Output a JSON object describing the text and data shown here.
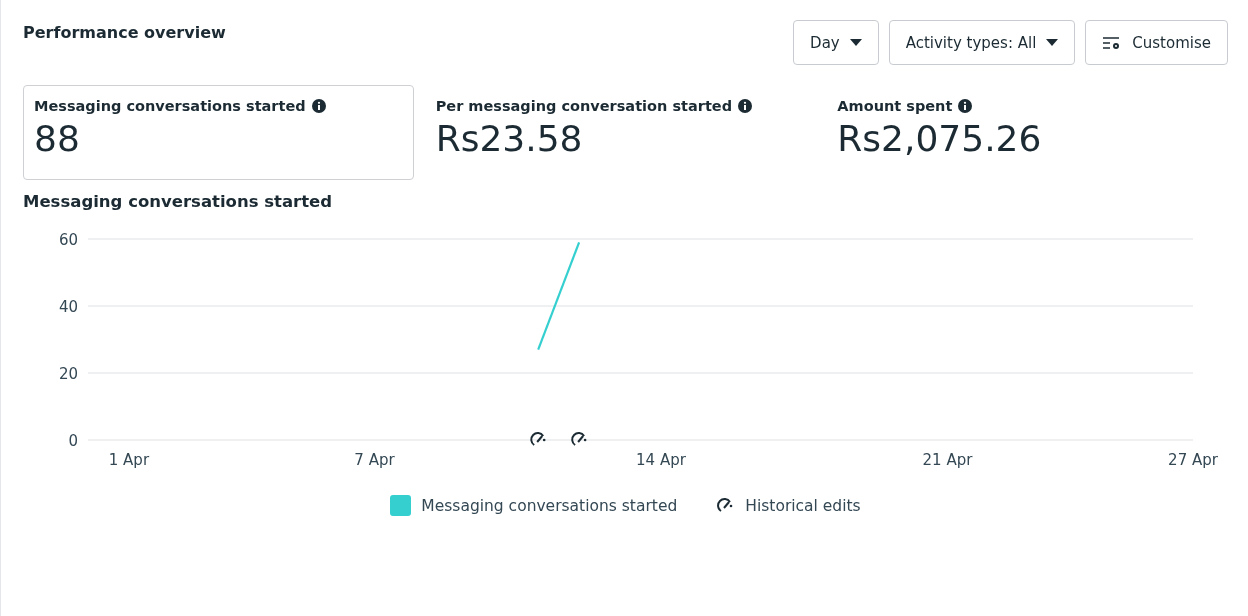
{
  "title": "Performance overview",
  "controls": [
    {
      "kind": "dropdown",
      "label": "Day"
    },
    {
      "kind": "dropdown",
      "label": "Activity types: All"
    },
    {
      "kind": "customise",
      "label": "Customise"
    }
  ],
  "metrics": [
    {
      "label": "Messaging conversations started",
      "value": "88",
      "selected": true
    },
    {
      "label": "Per messaging conversation started",
      "value": "Rs23.58",
      "selected": false
    },
    {
      "label": "Amount spent",
      "value": "Rs2,075.26",
      "selected": false
    }
  ],
  "chart": {
    "heading": "Messaging conversations started",
    "chart_data": {
      "type": "line",
      "categories": [
        null,
        "1 Apr",
        null,
        null,
        null,
        null,
        null,
        "7 Apr",
        null,
        null,
        null,
        null,
        null,
        null,
        "14 Apr",
        null,
        null,
        null,
        null,
        null,
        null,
        "21 Apr",
        null,
        null,
        null,
        null,
        null,
        "27 Apr"
      ],
      "ylim": [
        0,
        60
      ],
      "yticks": [
        0,
        20,
        40,
        60
      ],
      "series": [
        {
          "name": "Messaging conversations started",
          "color": "#35cfd0",
          "values": [
            null,
            null,
            null,
            null,
            null,
            null,
            null,
            null,
            null,
            null,
            null,
            27,
            59,
            null,
            null,
            null,
            null,
            null,
            null,
            null,
            null,
            null,
            null,
            null,
            null,
            null,
            null,
            null
          ]
        }
      ]
    },
    "edit_markers_on_points": true,
    "legend_marker": "Historical edits"
  }
}
